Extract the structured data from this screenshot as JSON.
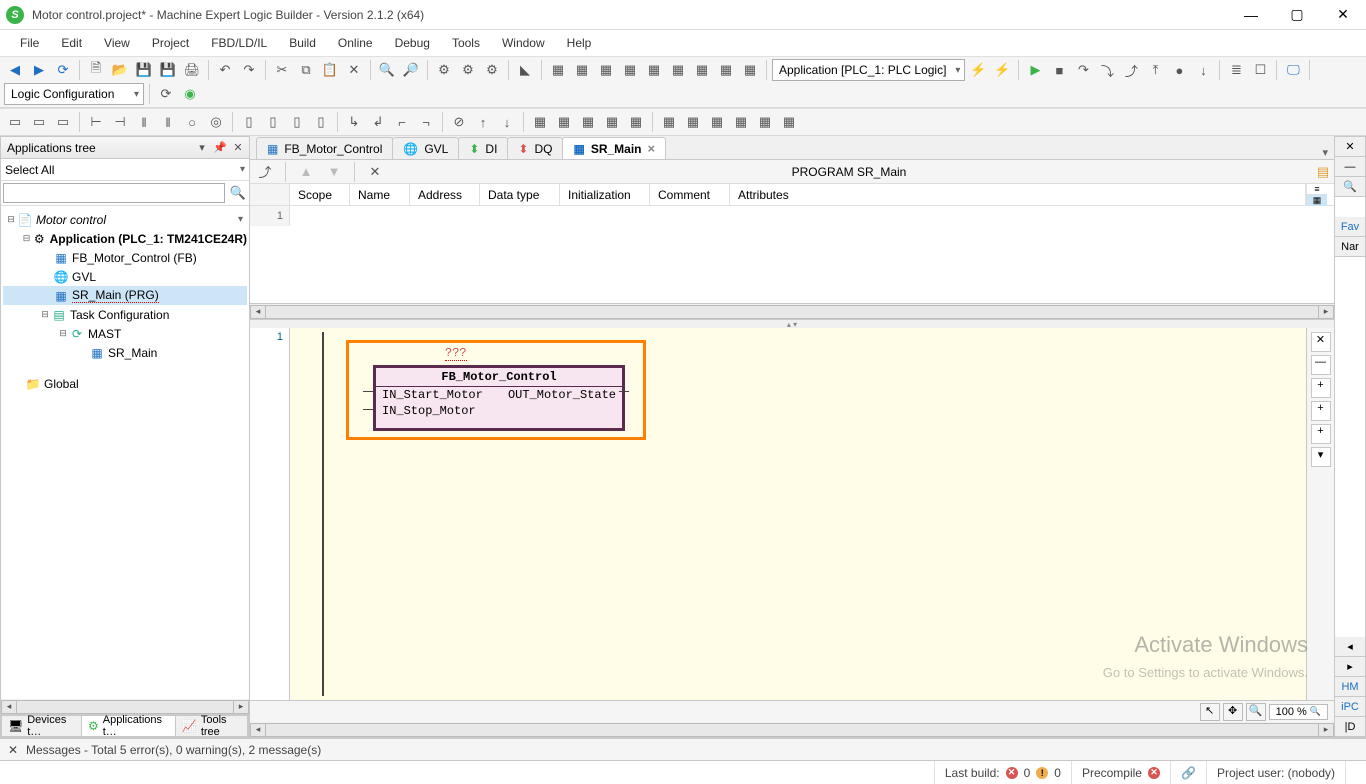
{
  "window": {
    "title": "Motor control.project* - Machine Expert Logic Builder - Version 2.1.2 (x64)"
  },
  "menu": [
    "File",
    "Edit",
    "View",
    "Project",
    "FBD/LD/IL",
    "Build",
    "Online",
    "Debug",
    "Tools",
    "Window",
    "Help"
  ],
  "toolbar": {
    "app_target": "Application [PLC_1: PLC Logic]",
    "config_combo": "Logic Configuration"
  },
  "applications_tree": {
    "title": "Applications tree",
    "filter": "Select All",
    "nodes": {
      "project": "Motor control",
      "application": "Application (PLC_1: TM241CE24R)",
      "fb_motor": "FB_Motor_Control (FB)",
      "gvl": "GVL",
      "sr_main": "SR_Main (PRG)",
      "task_cfg": "Task Configuration",
      "mast": "MAST",
      "sr_main_task": "SR_Main",
      "global": "Global"
    }
  },
  "bottom_tabs": {
    "devices": "Devices t…",
    "applications": "Applications t…",
    "tools": "Tools tree"
  },
  "editor": {
    "tabs": [
      {
        "icon": "fb",
        "label": "FB_Motor_Control"
      },
      {
        "icon": "gvl",
        "label": "GVL"
      },
      {
        "icon": "io",
        "label": "DI"
      },
      {
        "icon": "io",
        "label": "DQ"
      },
      {
        "icon": "fb",
        "label": "SR_Main",
        "active": true
      }
    ],
    "subtitle": "PROGRAM SR_Main",
    "decl_cols": [
      "Scope",
      "Name",
      "Address",
      "Data type",
      "Initialization",
      "Comment",
      "Attributes"
    ],
    "decl_row1": "1",
    "network_num": "1",
    "fb_instance": "???",
    "fb_type": "FB_Motor_Control",
    "fb_inputs": [
      "IN_Start_Motor",
      "IN_Stop_Motor"
    ],
    "fb_outputs": [
      "OUT_Motor_State"
    ],
    "zoom": "100 %"
  },
  "right_rail": {
    "fav": "Fav",
    "nar": "Nar",
    "hm": "HM",
    "ipc": "iPC",
    "d": "|D"
  },
  "messages": {
    "summary": "Messages - Total 5 error(s), 0 warning(s), 2 message(s)"
  },
  "status": {
    "last_build": "Last build:",
    "err": "0",
    "warn": "0",
    "precompile": "Precompile",
    "user": "Project user: (nobody)"
  },
  "watermark": {
    "l1": "Activate Windows",
    "l2": "Go to Settings to activate Windows."
  }
}
